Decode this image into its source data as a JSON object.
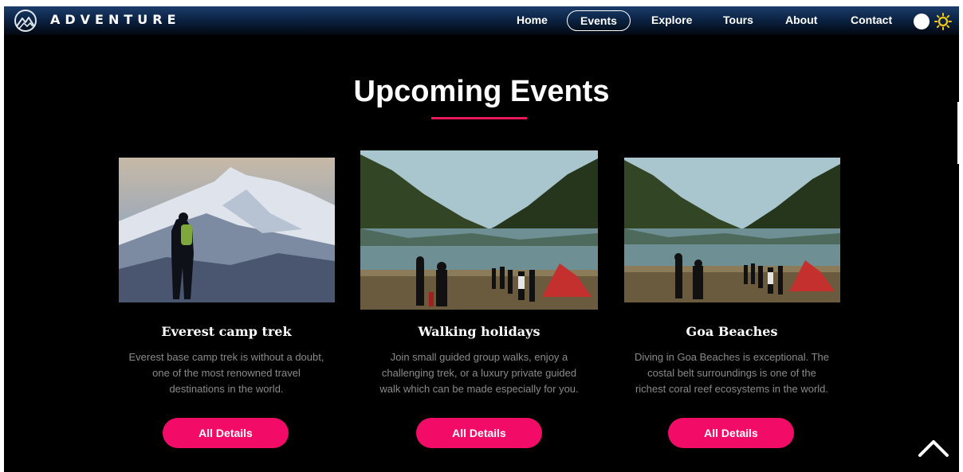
{
  "brand": {
    "name": "ADVENTURE",
    "logo_icon": "mountain-logo-icon"
  },
  "nav": {
    "items": [
      {
        "label": "Home",
        "active": false
      },
      {
        "label": "Events",
        "active": true
      },
      {
        "label": "Explore",
        "active": false
      },
      {
        "label": "Tours",
        "active": false
      },
      {
        "label": "About",
        "active": false
      },
      {
        "label": "Contact",
        "active": false
      }
    ],
    "theme_toggle_icon": "sun-icon"
  },
  "section": {
    "title": "Upcoming Events"
  },
  "cards": [
    {
      "title": "Everest camp trek",
      "description": "Everest base camp trek is without a doubt,\none of the most renowned travel\ndestinations in the world.",
      "button_label": "All Details",
      "image": "snowy-mountain-hiker-photo"
    },
    {
      "title": "Walking holidays",
      "description": "Join small guided group walks, enjoy a\nchallenging trek, or a luxury private guided\nwalk which can be made especially for you.",
      "button_label": "All Details",
      "image": "mountain-lake-camp-photo"
    },
    {
      "title": "Goa Beaches",
      "description": "Diving in Goa Beaches is exceptional. The\ncostal belt surroundings is one of the\nrichest coral reef ecosystems in the world.",
      "button_label": "All Details",
      "image": "mountain-lake-camp-photo"
    }
  ],
  "scroll_top_icon": "chevron-up-icon",
  "colors": {
    "accent": "#f20c67",
    "background": "#000000",
    "nav_top": "#1c3d6b"
  }
}
